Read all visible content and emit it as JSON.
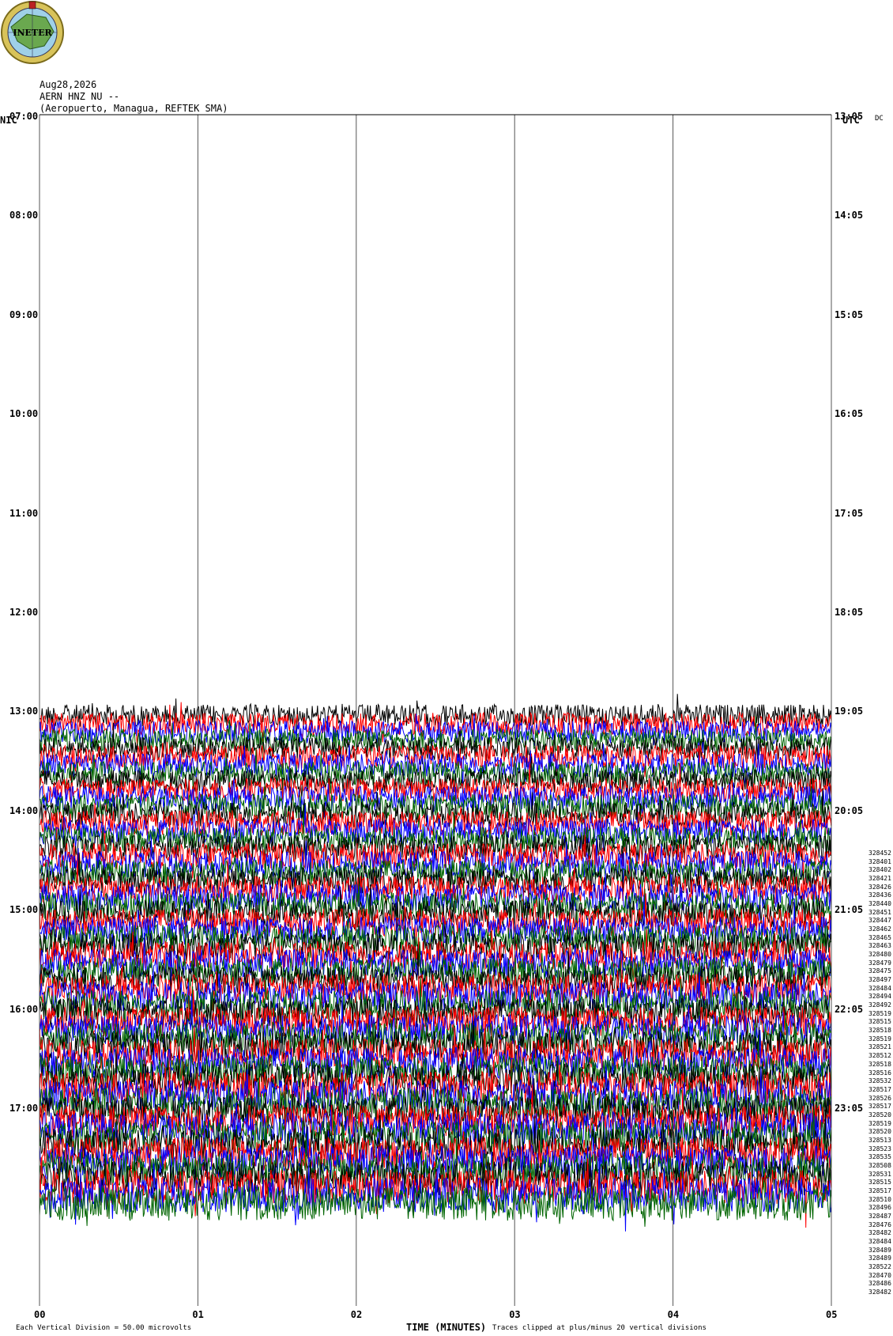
{
  "logo": {
    "text": "INETER",
    "colors": {
      "ring": "#c8b44a",
      "land": "#6aa84f",
      "water": "#9fd0e8"
    }
  },
  "header": {
    "date": "Aug28,2026",
    "station": "AERN HNZ NU --",
    "location": "(Aeropuerto, Managua, REFTEK SMA)"
  },
  "left_axis_title": "NIC",
  "right_axis_title": "UTC",
  "dc_label": "DC",
  "footer": {
    "scale_note": "Each Vertical Division =   50.00 microvolts",
    "xlabel": "TIME (MINUTES)",
    "clip_note": "Traces clipped at plus/minus 20 vertical divisions"
  },
  "chart_data": {
    "type": "line",
    "title": "",
    "xlabel": "TIME (MINUTES)",
    "x_ticks": [
      "00",
      "01",
      "02",
      "03",
      "04",
      "05"
    ],
    "xlim": [
      0,
      5
    ],
    "left_ticks": [
      "07:00",
      "08:00",
      "09:00",
      "10:00",
      "11:00",
      "12:00",
      "13:00",
      "14:00",
      "15:00",
      "16:00",
      "17:00"
    ],
    "right_ticks": [
      "13:05",
      "14:05",
      "15:05",
      "16:05",
      "17:05",
      "18:05",
      "19:05",
      "20:05",
      "21:05",
      "22:05",
      "23:05"
    ],
    "trace_colors": [
      "#000000",
      "#ff0000",
      "#0000ff",
      "#006400"
    ],
    "traces_start": "13:00",
    "traces_end": "18:00",
    "trace_interval_minutes": 5,
    "grid": true,
    "rms_labels": [
      "328452",
      "328401",
      "328402",
      "328421",
      "328426",
      "328436",
      "328440",
      "328451",
      "328447",
      "328462",
      "328465",
      "328463",
      "328480",
      "328479",
      "328475",
      "328497",
      "328484",
      "328494",
      "328492",
      "328519",
      "328515",
      "328518",
      "328519",
      "328521",
      "328512",
      "328518",
      "328516",
      "328532",
      "328517",
      "328526",
      "328517",
      "328520",
      "328519",
      "328520",
      "328513",
      "328523",
      "328535",
      "328508",
      "328531",
      "328515",
      "328517",
      "328510",
      "328496",
      "328487",
      "328476",
      "328482",
      "328484",
      "328489",
      "328489",
      "328522",
      "328470",
      "328486",
      "328482"
    ]
  }
}
